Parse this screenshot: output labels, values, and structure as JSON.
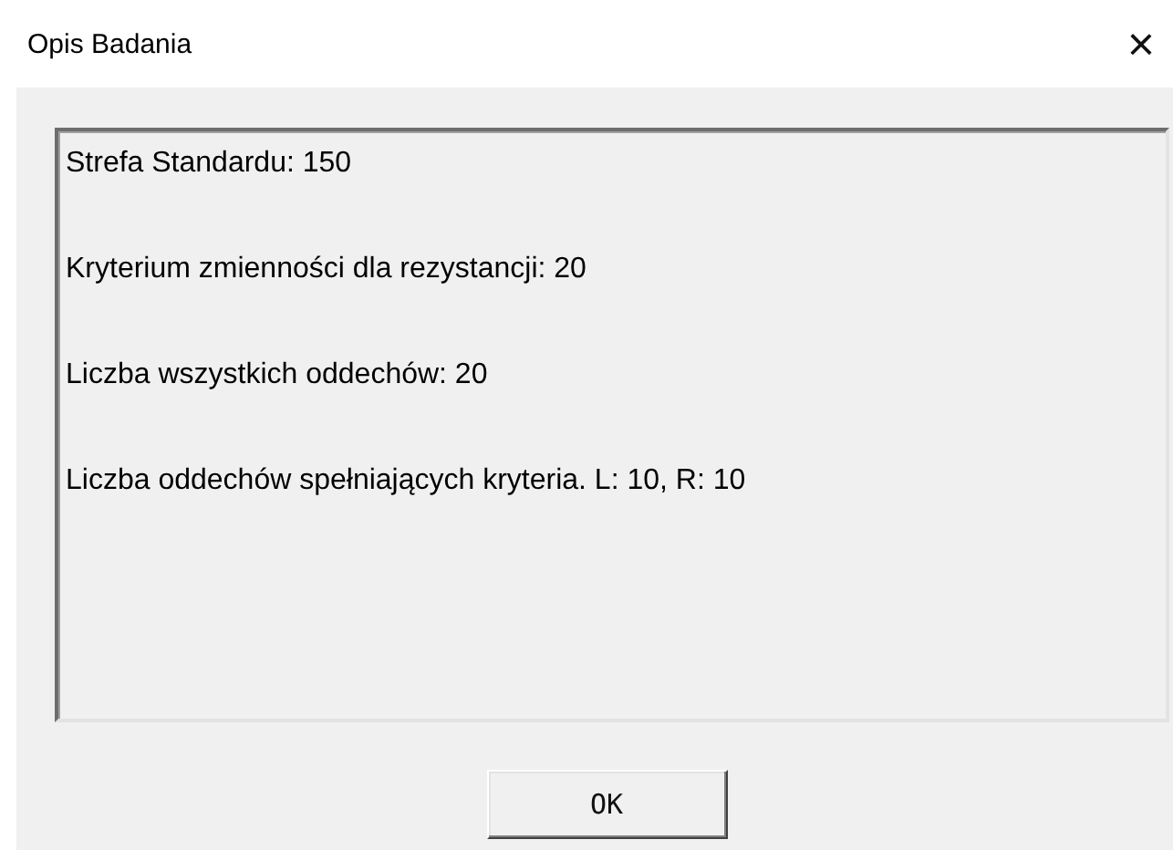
{
  "window": {
    "title": "Opis Badania",
    "close": "×"
  },
  "lines": [
    "Strefa Standardu: 150",
    "Kryterium zmienności dla rezystancji: 20",
    "Liczba wszystkich oddechów: 20",
    "Liczba oddechów spełniających kryteria. L: 10, R: 10"
  ],
  "buttons": [
    "OK"
  ]
}
